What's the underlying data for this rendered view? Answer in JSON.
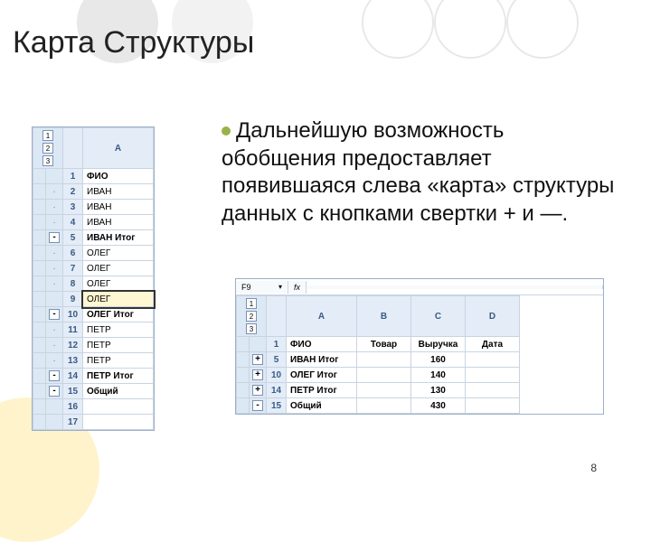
{
  "title": "Карта Структуры",
  "body": "Дальнейшую возможность обобщения предоставляет появившаяся слева «карта» структуры данных с кнопками свертки + и —.",
  "page_num": "8",
  "ss1": {
    "levels": [
      "1",
      "2",
      "3"
    ],
    "colA": "A",
    "rows": [
      {
        "n": "1",
        "btn": "",
        "v": "ФИО",
        "b": true
      },
      {
        "n": "2",
        "btn": "·",
        "v": "ИВАН"
      },
      {
        "n": "3",
        "btn": "·",
        "v": "ИВАН"
      },
      {
        "n": "4",
        "btn": "·",
        "v": "ИВАН"
      },
      {
        "n": "5",
        "btn": "-",
        "v": "ИВАН Итог",
        "b": true
      },
      {
        "n": "6",
        "btn": "·",
        "v": "ОЛЕГ"
      },
      {
        "n": "7",
        "btn": "·",
        "v": "ОЛЕГ"
      },
      {
        "n": "8",
        "btn": "·",
        "v": "ОЛЕГ"
      },
      {
        "n": "9",
        "btn": "",
        "v": "ОЛЕГ",
        "sel": true
      },
      {
        "n": "10",
        "btn": "-",
        "v": "ОЛЕГ Итог",
        "b": true
      },
      {
        "n": "11",
        "btn": "·",
        "v": "ПЕТР"
      },
      {
        "n": "12",
        "btn": "·",
        "v": "ПЕТР"
      },
      {
        "n": "13",
        "btn": "·",
        "v": "ПЕТР"
      },
      {
        "n": "14",
        "btn": "-",
        "v": "ПЕТР Итог",
        "b": true
      },
      {
        "n": "15",
        "btn": "-",
        "v": "Общий",
        "b": true
      },
      {
        "n": "16",
        "btn": "",
        "v": ""
      },
      {
        "n": "17",
        "btn": "",
        "v": ""
      }
    ]
  },
  "ss2": {
    "namebox": "F9",
    "fx": "fx",
    "levels": [
      "1",
      "2",
      "3"
    ],
    "cols": [
      "A",
      "B",
      "C",
      "D"
    ],
    "header": [
      "ФИО",
      "Товар",
      "Выручка",
      "Дата"
    ],
    "rows": [
      {
        "n": "1",
        "btn": "",
        "cells": [
          "ФИО",
          "Товар",
          "Выручка",
          "Дата"
        ],
        "b": true
      },
      {
        "n": "5",
        "btn": "+",
        "cells": [
          "ИВАН Итог",
          "",
          "160",
          ""
        ],
        "b": true
      },
      {
        "n": "10",
        "btn": "+",
        "cells": [
          "ОЛЕГ Итог",
          "",
          "140",
          ""
        ],
        "b": true
      },
      {
        "n": "14",
        "btn": "+",
        "cells": [
          "ПЕТР Итог",
          "",
          "130",
          ""
        ],
        "b": true
      },
      {
        "n": "15",
        "btn": "-",
        "cells": [
          "Общий",
          "",
          "430",
          ""
        ],
        "b": true
      }
    ]
  }
}
